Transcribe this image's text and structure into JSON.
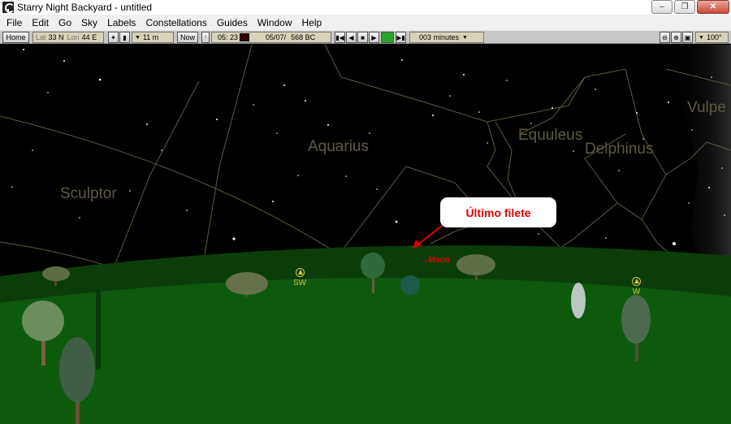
{
  "window": {
    "title": "Starry Night Backyard - untitled",
    "minimize_label": "‒",
    "restore_label": "❐",
    "close_label": "✕"
  },
  "menu": [
    "File",
    "Edit",
    "Go",
    "Sky",
    "Labels",
    "Constellations",
    "Guides",
    "Window",
    "Help"
  ],
  "toolbar": {
    "home_label": "Home",
    "lat_label": "Lat",
    "lat_value": "33 N",
    "lon_label": "Lon",
    "lon_value": "44 E",
    "elevation": "11 m",
    "now_label": "Now",
    "time_value": "05: 23",
    "time_seconds": "00",
    "date_value": "05/07/",
    "year_value": "568 BC",
    "step_value": "003 minutes",
    "fov_value": "100°"
  },
  "sky": {
    "constellations": [
      "Sculptor",
      "Aquarius",
      "Equuleus",
      "Delphinus",
      "Vulpe"
    ],
    "compass_sw": "SW",
    "compass_w": "W",
    "moon_label": "→Moon",
    "callout_text": "Último filete"
  },
  "colors": {
    "sky": "#000000",
    "ground_far": "#0b3d0b",
    "ground_near": "#0d5a0d",
    "constellation_line": "#5e5a3e",
    "callout_text": "#e00000"
  }
}
